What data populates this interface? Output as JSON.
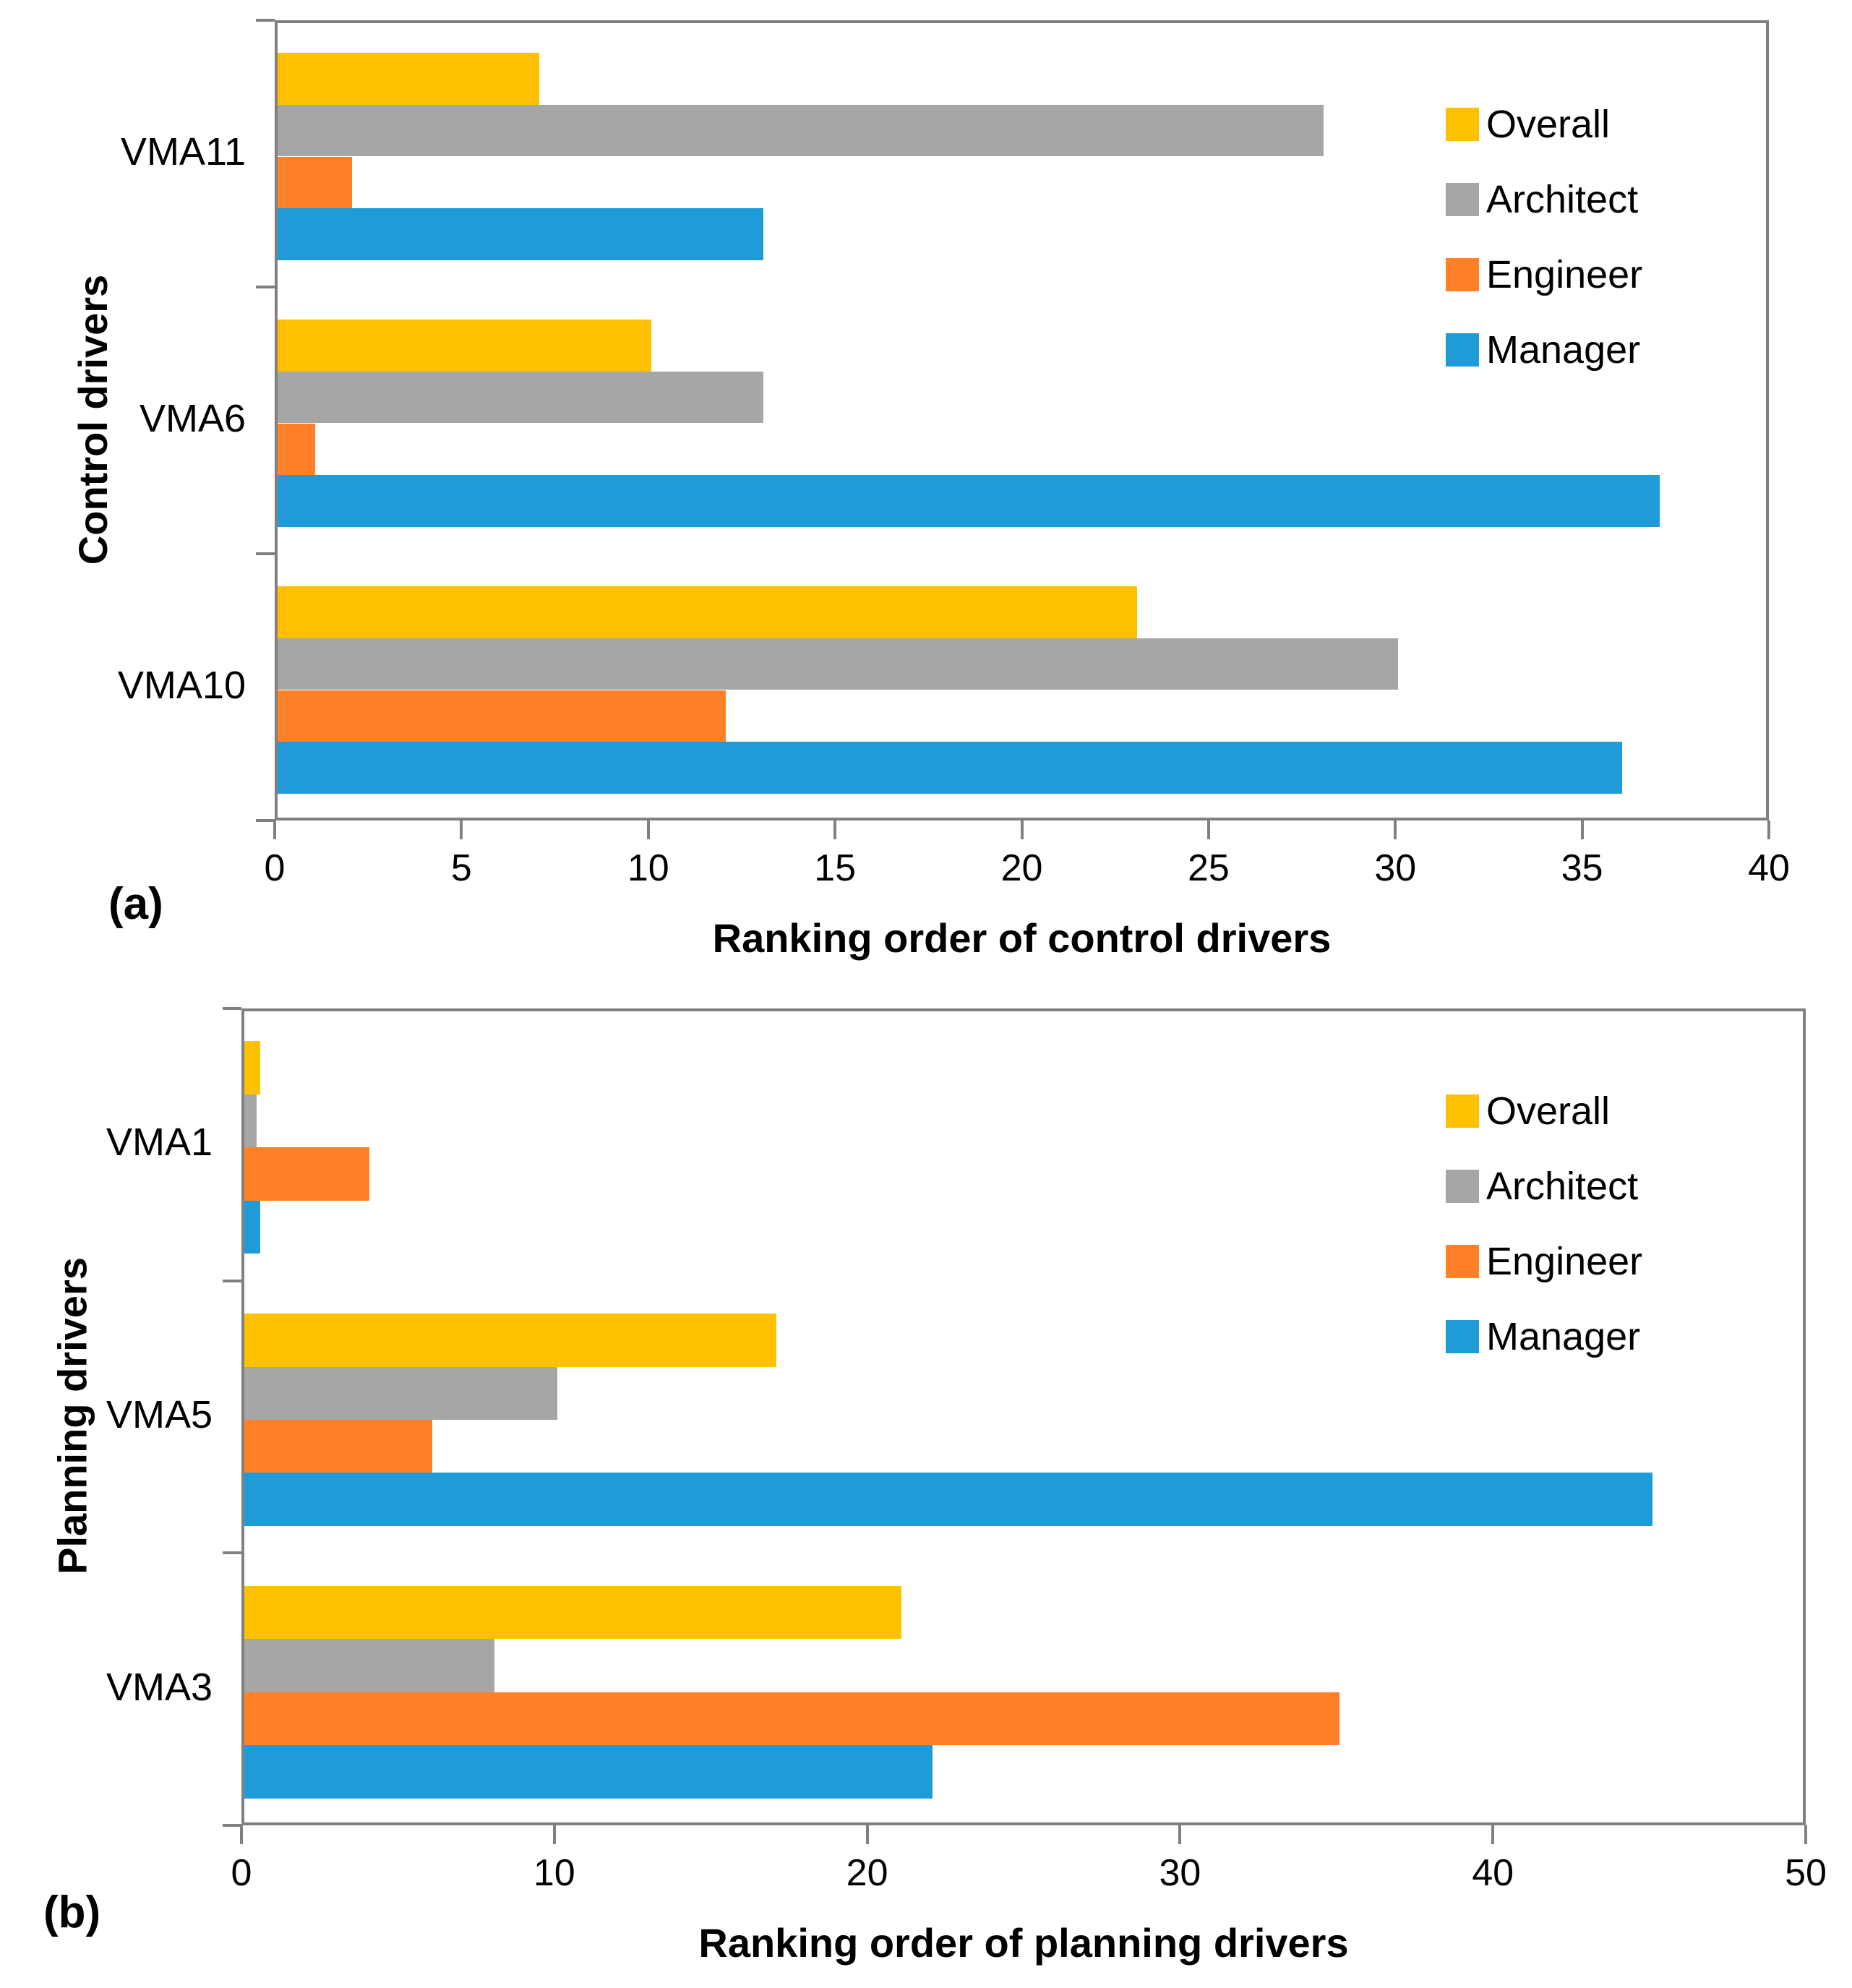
{
  "figure": {
    "panels": [
      {
        "caption": "(a)",
        "ylabel": "Control drivers",
        "xlabel": "Ranking order of control drivers"
      },
      {
        "caption": "(b)",
        "ylabel": "Planning drivers",
        "xlabel": "Ranking order of planning drivers"
      }
    ],
    "legend": [
      {
        "label": "Overall",
        "color": "#FFC000"
      },
      {
        "label": "Architect",
        "color": "#A6A6A6"
      },
      {
        "label": "Engineer",
        "color": "#FF8026"
      },
      {
        "label": "Manager",
        "color": "#1F9BD8"
      }
    ],
    "axis_color": "#808080"
  },
  "chart_data": [
    {
      "type": "bar",
      "orientation": "horizontal",
      "title": "",
      "xlabel": "Ranking order of control drivers",
      "ylabel": "Control drivers",
      "categories": [
        "VMA11",
        "VMA6",
        "VMA10"
      ],
      "series": [
        {
          "name": "Overall",
          "color": "#FFC000",
          "values": [
            7,
            10,
            23
          ]
        },
        {
          "name": "Architect",
          "color": "#A6A6A6",
          "values": [
            28,
            13,
            30
          ]
        },
        {
          "name": "Engineer",
          "color": "#FF8026",
          "values": [
            2,
            1,
            12
          ]
        },
        {
          "name": "Manager",
          "color": "#1F9BD8",
          "values": [
            13,
            37,
            36
          ]
        }
      ],
      "xlim": [
        0,
        40
      ],
      "xticks": [
        0,
        5,
        10,
        15,
        20,
        25,
        30,
        35,
        40
      ],
      "grid": false,
      "legend_position": "top-right"
    },
    {
      "type": "bar",
      "orientation": "horizontal",
      "title": "",
      "xlabel": "Ranking order of planning drivers",
      "ylabel": "Planning drivers",
      "categories": [
        "VMA1",
        "VMA5",
        "VMA3"
      ],
      "series": [
        {
          "name": "Overall",
          "color": "#FFC000",
          "values": [
            0.5,
            17,
            21
          ]
        },
        {
          "name": "Architect",
          "color": "#A6A6A6",
          "values": [
            0.4,
            10,
            8
          ]
        },
        {
          "name": "Engineer",
          "color": "#FF8026",
          "values": [
            4,
            6,
            35
          ]
        },
        {
          "name": "Manager",
          "color": "#1F9BD8",
          "values": [
            0.5,
            45,
            22
          ]
        }
      ],
      "xlim": [
        0,
        50
      ],
      "xticks": [
        0,
        10,
        20,
        30,
        40,
        50
      ],
      "grid": false,
      "legend_position": "top-right"
    }
  ]
}
